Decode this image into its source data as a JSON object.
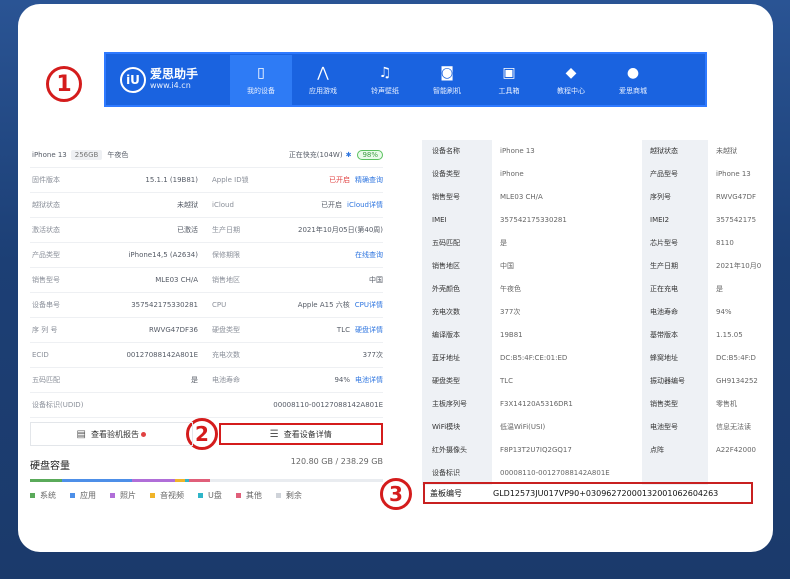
{
  "nav": {
    "logo_name": "爱思助手",
    "logo_url": "www.i4.cn",
    "items": [
      {
        "label": "我的设备",
        "icon": "phone-icon",
        "glyph": "▯"
      },
      {
        "label": "应用游戏",
        "icon": "app-store-icon",
        "glyph": "⋀"
      },
      {
        "label": "铃声壁纸",
        "icon": "music-icon",
        "glyph": "♫"
      },
      {
        "label": "智能刷机",
        "icon": "flash-icon",
        "glyph": "◙"
      },
      {
        "label": "工具箱",
        "icon": "toolbox-icon",
        "glyph": "▣"
      },
      {
        "label": "教程中心",
        "icon": "graduation-icon",
        "glyph": "◆"
      },
      {
        "label": "爱思商城",
        "icon": "shop-icon",
        "glyph": "●"
      }
    ]
  },
  "markers": [
    "1",
    "2",
    "3"
  ],
  "device": {
    "name": "iPhone 13",
    "capacity": "256GB",
    "color": "午夜色",
    "charging": "正在快充(104W)",
    "battery": "98%"
  },
  "left_rows": [
    {
      "k1": "固件版本",
      "v1": "15.1.1 (19B81)",
      "k2": "Apple ID锁",
      "v2": "已开启",
      "v2_class": "red",
      "link": "精确查询"
    },
    {
      "k1": "越狱状态",
      "v1": "未越狱",
      "k2": "iCloud",
      "v2": "已开启",
      "v2_class": "",
      "link": "iCloud详情"
    },
    {
      "k1": "激活状态",
      "v1": "已激活",
      "k2": "生产日期",
      "v2": "2021年10月05日(第40周)",
      "v2_class": "",
      "link": ""
    },
    {
      "k1": "产品类型",
      "v1": "iPhone14,5 (A2634)",
      "k2": "保修期限",
      "v2": "",
      "v2_class": "",
      "link": "在线查询"
    },
    {
      "k1": "销售型号",
      "v1": "MLE03 CH/A",
      "k2": "销售地区",
      "v2": "中国",
      "v2_class": "",
      "link": ""
    },
    {
      "k1": "设备串号",
      "v1": "357542175330281",
      "k2": "CPU",
      "v2": "Apple A15 六核",
      "v2_class": "",
      "link": "CPU详情"
    },
    {
      "k1": "序 列 号",
      "v1": "RWVG47DF36",
      "k2": "硬盘类型",
      "v2": "TLC",
      "v2_class": "",
      "link": "硬盘详情"
    },
    {
      "k1": "ECID",
      "v1": "00127088142A801E",
      "k2": "充电次数",
      "v2": "377次",
      "v2_class": "",
      "link": ""
    },
    {
      "k1": "五码匹配",
      "v1": "是",
      "k2": "电池寿命",
      "v2": "94%",
      "v2_class": "",
      "link": "电池详情"
    }
  ],
  "udid_label": "设备标识(UDID)",
  "udid_value": "00008110-00127088142A801E",
  "buttons": {
    "report": "查看验机报告",
    "details": "查看设备详情"
  },
  "disk": {
    "title": "硬盘容量",
    "size": "120.80 GB / 238.29 GB",
    "segments": [
      {
        "name": "系统",
        "fraction": 0.09,
        "color": "#5aaa5a"
      },
      {
        "name": "应用",
        "fraction": 0.2,
        "color": "#4d8fe8"
      },
      {
        "name": "照片",
        "fraction": 0.12,
        "color": "#b06ed8"
      },
      {
        "name": "音视频",
        "fraction": 0.03,
        "color": "#f0b429"
      },
      {
        "name": "U盘",
        "fraction": 0.01,
        "color": "#2fb5c8"
      },
      {
        "name": "其他",
        "fraction": 0.06,
        "color": "#e05f7a"
      },
      {
        "name": "剩余",
        "fraction": 0.49,
        "color": "#e9ecf0"
      }
    ]
  },
  "right_rows": [
    {
      "k": "设备名称",
      "v": "iPhone 13",
      "k2": "越狱状态",
      "v2": "未越狱"
    },
    {
      "k": "设备类型",
      "v": "iPhone",
      "k2": "产品型号",
      "v2": "iPhone 13"
    },
    {
      "k": "销售型号",
      "v": "MLE03 CH/A",
      "k2": "序列号",
      "v2": "RWVG47DF"
    },
    {
      "k": "IMEI",
      "v": "357542175330281",
      "k2": "IMEI2",
      "v2": "357542175"
    },
    {
      "k": "五码匹配",
      "v": "是",
      "k2": "芯片型号",
      "v2": "8110"
    },
    {
      "k": "销售地区",
      "v": "中国",
      "k2": "生产日期",
      "v2": "2021年10月0"
    },
    {
      "k": "外壳颜色",
      "v": "午夜色",
      "k2": "正在充电",
      "v2": "是"
    },
    {
      "k": "充电次数",
      "v": "377次",
      "k2": "电池寿命",
      "v2": "94%"
    },
    {
      "k": "编译版本",
      "v": "19B81",
      "k2": "基带版本",
      "v2": "1.15.05"
    },
    {
      "k": "蓝牙地址",
      "v": "DC:B5:4F:CE:01:ED",
      "k2": "蜂窝地址",
      "v2": "DC:B5:4F:D"
    },
    {
      "k": "硬盘类型",
      "v": "TLC",
      "k2": "振动器编号",
      "v2": "GH9134252"
    },
    {
      "k": "主板序列号",
      "v": "F3X14120A5316DR1",
      "k2": "销售类型",
      "v2": "零售机"
    },
    {
      "k": "WiFi模块",
      "v": "低温WiFi(USI)",
      "k2": "电池型号",
      "v2": "信息无法读"
    },
    {
      "k": "红外摄像头",
      "v": "F8P13T2U7IQ2GQ17",
      "k2": "点阵",
      "v2": "A22F42000"
    },
    {
      "k": "设备标识",
      "v": "00008110-00127088142A801E",
      "k2": "",
      "v2": ""
    }
  ],
  "highlight_row": {
    "k": "盖板编号",
    "v": "GLD12573JU017VP90+0309627200013200106260426​3"
  }
}
